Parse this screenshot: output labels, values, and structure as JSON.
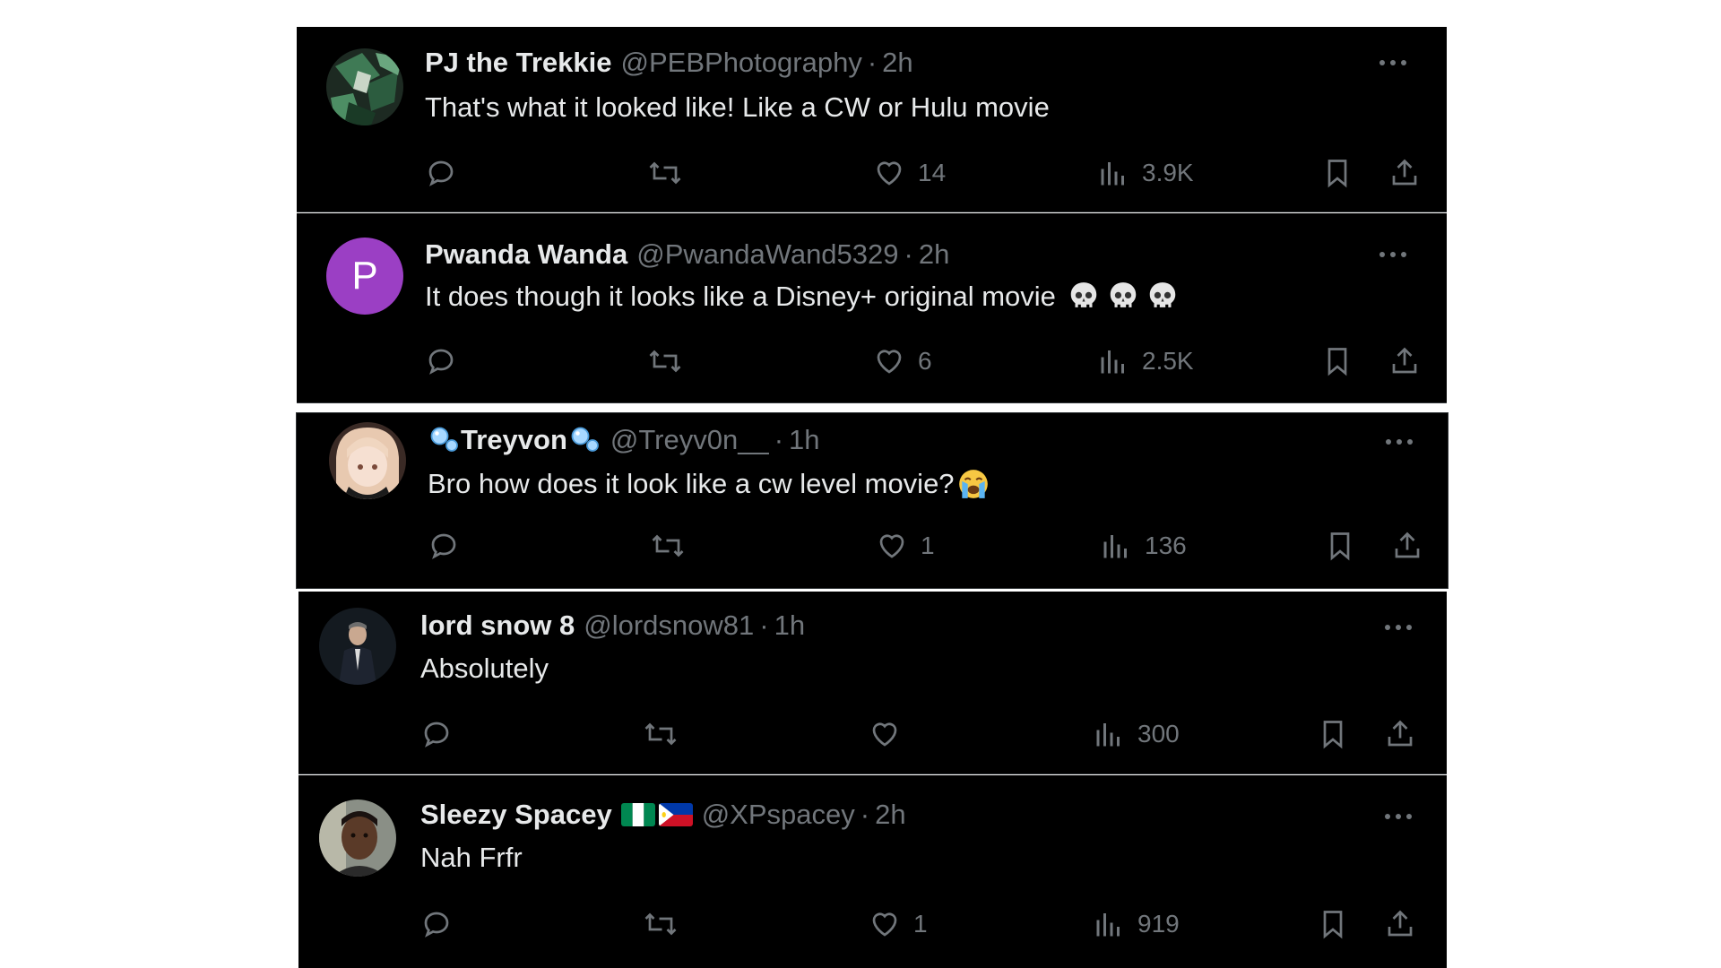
{
  "colors": {
    "background": "#000000",
    "text_primary": "#e7e9ea",
    "text_secondary": "#71767b",
    "divider": "#2f3336",
    "avatar_p": "#9b3fc4"
  },
  "posts": [
    {
      "display_name": "PJ the Trekkie",
      "handle": "@PEBPhotography",
      "separator": "·",
      "time": "2h",
      "text": "That's what it looked like! Like a CW or Hulu movie",
      "likes": "14",
      "views": "3.9K",
      "avatar_kind": "camo"
    },
    {
      "display_name": "Pwanda Wanda",
      "handle": "@PwandaWand5329",
      "separator": "·",
      "time": "2h",
      "text": "It does though it looks like a Disney+ original movie",
      "text_emoji": "skull-emoji x3",
      "likes": "6",
      "views": "2.5K",
      "avatar_kind": "letter",
      "avatar_letter": "P"
    },
    {
      "display_name": "Treyvon",
      "handle": "@Treyv0n__",
      "separator": "·",
      "time": "1h",
      "text": "Bro how does it look like a cw level movie?",
      "text_emoji": "loudly-crying-emoji",
      "likes": "1",
      "views": "136",
      "avatar_kind": "anime"
    },
    {
      "display_name": "lord snow 8",
      "handle": "@lordsnow81",
      "separator": "·",
      "time": "1h",
      "text": "Absolutely",
      "likes": "",
      "views": "300",
      "avatar_kind": "suit"
    },
    {
      "display_name": "Sleezy Spacey",
      "handle": "@XPspacey",
      "separator": "·",
      "time": "2h",
      "text": "Nah Frfr",
      "likes": "1",
      "views": "919",
      "avatar_kind": "photo",
      "name_flags": [
        "nigeria-flag",
        "philippines-flag"
      ]
    }
  ]
}
